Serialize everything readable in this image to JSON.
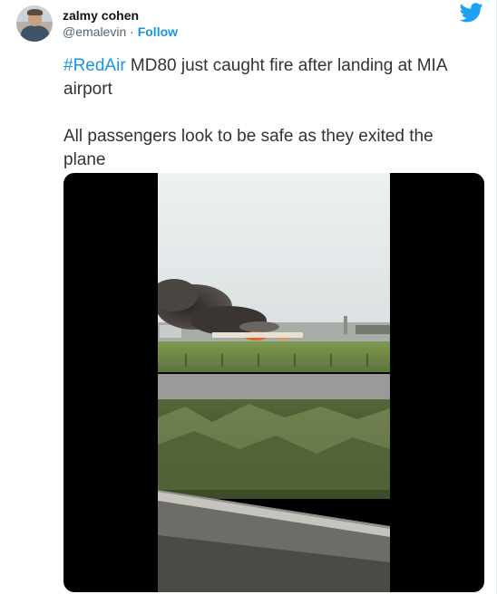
{
  "author": {
    "display_name": "zalmy cohen",
    "handle": "@emalevin",
    "separator": "·",
    "follow_label": "Follow",
    "avatar_icon": "user-avatar"
  },
  "brand": {
    "icon": "twitter-bird-icon",
    "color": "#1da1f2"
  },
  "tweet": {
    "hashtag": "#RedAir",
    "line1_rest": " MD80 just caught fire after landing at MIA airport",
    "line2": "All passengers look to be safe as they exited the plane"
  },
  "media": {
    "type": "video-frame",
    "description_icon": "airplane-fire-video"
  },
  "colors": {
    "link": "#1b95e0",
    "text": "#333333",
    "muted": "#536471"
  }
}
